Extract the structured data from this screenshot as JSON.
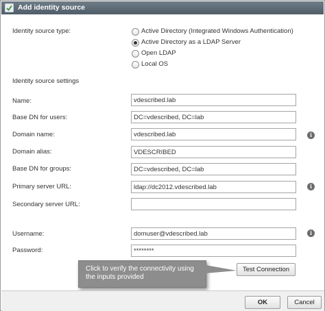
{
  "dialog": {
    "title": "Add identity source",
    "icon": "add-identity-icon"
  },
  "source_type": {
    "label": "Identity source type:",
    "options": [
      {
        "label": "Active Directory (Integrated Windows Authentication)",
        "selected": false
      },
      {
        "label": "Active Directory as a LDAP Server",
        "selected": true
      },
      {
        "label": "Open LDAP",
        "selected": false
      },
      {
        "label": "Local OS",
        "selected": false
      }
    ]
  },
  "settings": {
    "heading": "Identity source settings",
    "name": {
      "label": "Name:",
      "value": "vdescribed.lab"
    },
    "base_dn_users": {
      "label": "Base DN for users:",
      "value": "DC=vdescribed, DC=lab"
    },
    "domain_name": {
      "label": "Domain name:",
      "value": "vdescribed.lab"
    },
    "domain_alias": {
      "label": "Domain alias:",
      "value": "VDESCRIBED"
    },
    "base_dn_groups": {
      "label": "Base DN for groups:",
      "value": "DC=vdescribed, DC=lab"
    },
    "primary_url": {
      "label": "Primary server URL:",
      "value": "ldap://dc2012.vdescribed.lab"
    },
    "secondary_url": {
      "label": "Secondary server URL:",
      "value": ""
    },
    "username": {
      "label": "Username:",
      "value": "domuser@vdescribed.lab"
    },
    "password": {
      "label": "Password:",
      "value": "********"
    }
  },
  "buttons": {
    "test_connection": "Test Connection",
    "ok": "OK",
    "cancel": "Cancel"
  },
  "tooltip": {
    "text": "Click to verify the connectivity using the inputs provided"
  },
  "colors": {
    "titlebar": "#5a6874",
    "tooltip": "#8d8d8d",
    "info_icon": "#6b6b6b"
  }
}
